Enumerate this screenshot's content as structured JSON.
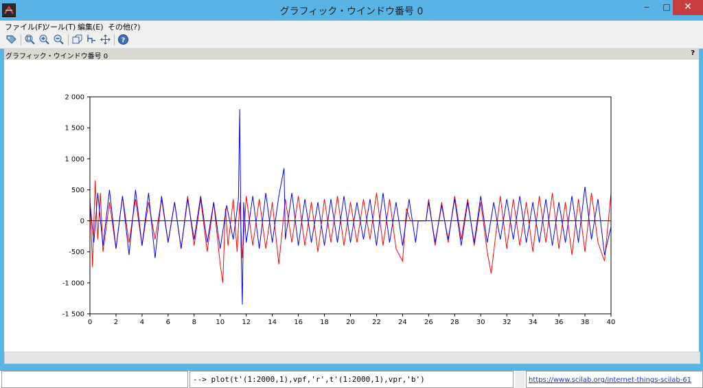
{
  "window": {
    "title": "グラフィック・ウインドウ番号 0",
    "close_label": "✕",
    "maximize_label": "□",
    "minimize_label": "‒"
  },
  "menu": {
    "items": [
      "ファイル(F)",
      "ツール(T)",
      "編集(E)",
      "その他(?)"
    ]
  },
  "toolbar": {
    "icons": [
      "datatip-icon",
      "zoom-area-icon",
      "zoom-in-icon",
      "zoom-out-icon",
      "rotate-3d-icon",
      "datatip-manager-icon",
      "pan-icon",
      "help-icon"
    ]
  },
  "tab": {
    "title": "グラフィック・ウインドウ番号 0",
    "help": "?"
  },
  "console": {
    "command": "--> plot(t'(1:2000,1),vpf,'r',t'(1:2000,1),vpr,'b')",
    "link": "https://www.scilab.org/internet-things-scilab-61"
  },
  "colors": {
    "series_red": "#ff0000",
    "series_blue": "#0000ff",
    "titlebar": "#59b4e6"
  },
  "chart_data": {
    "type": "line",
    "xlabel": "",
    "ylabel": "",
    "xlim": [
      0,
      40
    ],
    "ylim": [
      -1500,
      2000
    ],
    "xticks": [
      0,
      2,
      4,
      6,
      8,
      10,
      12,
      14,
      16,
      18,
      20,
      22,
      24,
      26,
      28,
      30,
      32,
      34,
      36,
      38,
      40
    ],
    "yticks": [
      -1500,
      -1000,
      -500,
      0,
      500,
      1000,
      1500,
      2000
    ],
    "ytick_labels": [
      "-1 500",
      "-1 000",
      "-500",
      "0",
      "500",
      "1 000",
      "1 500",
      "2 000"
    ],
    "grid": false,
    "series": [
      {
        "color": "#ff0000",
        "x": [
          0.0,
          0.2,
          0.4,
          0.6,
          0.8,
          1.0,
          1.5,
          2.0,
          2.5,
          3.0,
          3.5,
          4.0,
          4.5,
          5.0,
          5.5,
          6.0,
          6.5,
          7.0,
          7.5,
          8.0,
          8.5,
          9.0,
          9.5,
          10.0,
          10.2,
          10.4,
          10.6,
          11.0,
          11.3,
          11.5,
          11.7,
          12.0,
          12.5,
          13.0,
          13.5,
          14.0,
          14.5,
          15.0,
          15.5,
          16.0,
          16.5,
          17.0,
          17.5,
          18.0,
          18.5,
          19.0,
          19.5,
          20.0,
          20.5,
          21.0,
          21.5,
          22.0,
          22.5,
          23.0,
          23.5,
          24.0,
          24.3,
          24.6,
          25.0,
          25.2,
          25.8,
          26.0,
          26.5,
          27.0,
          27.5,
          28.0,
          28.5,
          29.0,
          29.5,
          30.0,
          30.5,
          30.8,
          31.0,
          31.5,
          32.0,
          32.5,
          33.0,
          33.5,
          34.0,
          34.5,
          35.0,
          35.5,
          36.0,
          36.5,
          37.0,
          37.5,
          38.0,
          38.5,
          39.0,
          39.5,
          40.0
        ],
        "y": [
          400,
          -750,
          650,
          -300,
          450,
          -500,
          300,
          -450,
          400,
          -350,
          350,
          -400,
          300,
          -300,
          350,
          -350,
          300,
          -450,
          400,
          -400,
          350,
          -500,
          300,
          -700,
          -1000,
          200,
          -400,
          350,
          -500,
          300,
          -600,
          400,
          -400,
          350,
          -450,
          300,
          -700,
          350,
          -350,
          400,
          -400,
          300,
          -500,
          350,
          -350,
          400,
          -400,
          300,
          -350,
          350,
          -300,
          450,
          -400,
          350,
          -450,
          -650,
          200,
          0,
          0,
          0,
          0,
          350,
          -400,
          300,
          -350,
          400,
          -300,
          350,
          -400,
          300,
          -500,
          -850,
          -500,
          400,
          -450,
          350,
          -400,
          300,
          -500,
          400,
          -350,
          450,
          -450,
          300,
          -550,
          350,
          -500,
          450,
          -350,
          -650,
          450
        ]
      },
      {
        "color": "#0000ff",
        "x": [
          0.0,
          0.3,
          0.6,
          1.0,
          1.5,
          2.0,
          2.5,
          3.0,
          3.5,
          4.0,
          4.5,
          5.0,
          5.5,
          6.0,
          6.5,
          7.0,
          7.5,
          8.0,
          8.5,
          9.0,
          9.5,
          10.0,
          10.5,
          11.0,
          11.4,
          11.5,
          11.6,
          11.7,
          11.8,
          12.0,
          12.5,
          13.0,
          13.5,
          14.0,
          14.5,
          14.9,
          15.0,
          15.5,
          16.0,
          16.5,
          17.0,
          17.5,
          18.0,
          18.5,
          19.0,
          19.5,
          20.0,
          20.5,
          21.0,
          21.5,
          22.0,
          22.5,
          23.0,
          23.5,
          24.0,
          24.5,
          25.0,
          25.2,
          25.8,
          26.0,
          26.5,
          27.0,
          27.5,
          28.0,
          28.5,
          29.0,
          29.5,
          30.0,
          30.5,
          31.0,
          31.5,
          32.0,
          32.5,
          33.0,
          33.5,
          34.0,
          34.5,
          35.0,
          35.5,
          36.0,
          36.5,
          37.0,
          37.5,
          38.0,
          38.5,
          39.0,
          39.5,
          40.0
        ],
        "y": [
          300,
          -350,
          450,
          -400,
          500,
          -450,
          400,
          -550,
          500,
          -400,
          450,
          -600,
          400,
          -350,
          300,
          -450,
          350,
          -300,
          400,
          -350,
          300,
          -450,
          250,
          -300,
          350,
          1800,
          -400,
          -1350,
          300,
          -350,
          400,
          -450,
          450,
          -350,
          400,
          850,
          -300,
          450,
          -400,
          350,
          -350,
          300,
          -400,
          350,
          -350,
          400,
          -350,
          300,
          -300,
          350,
          -400,
          450,
          -350,
          300,
          -400,
          350,
          -350,
          0,
          0,
          300,
          -350,
          250,
          -300,
          350,
          -400,
          300,
          -350,
          400,
          -350,
          300,
          -300,
          350,
          -300,
          400,
          -350,
          300,
          -350,
          350,
          -400,
          300,
          -350,
          400,
          -350,
          550,
          -300,
          350,
          -550,
          -100
        ]
      }
    ]
  }
}
